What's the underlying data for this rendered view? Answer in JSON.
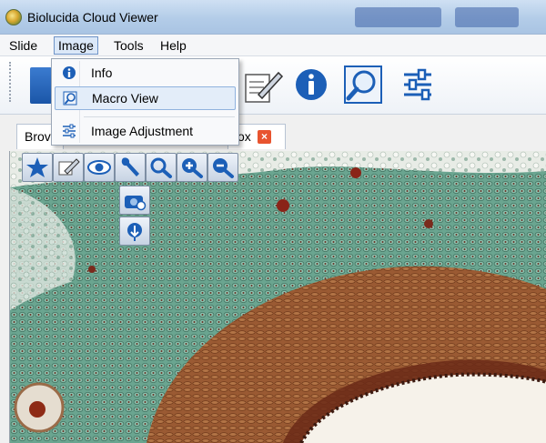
{
  "window": {
    "title": "Biolucida Cloud Viewer"
  },
  "menubar": {
    "items": [
      {
        "label": "Slide"
      },
      {
        "label": "Image"
      },
      {
        "label": "Tools"
      },
      {
        "label": "Help"
      }
    ]
  },
  "image_menu": {
    "items": [
      {
        "label": "Info",
        "icon": "info-icon"
      },
      {
        "label": "Macro View",
        "icon": "magnifier-icon"
      },
      {
        "label": "Image Adjustment",
        "icon": "sliders-icon"
      }
    ]
  },
  "tabs": [
    {
      "label": "Brov"
    },
    {
      "label": "ox"
    }
  ],
  "colors": {
    "accent": "#1b5fb8",
    "close": "#e8542f",
    "stain_green": "#5f9a86",
    "stain_brown": "#8c4a27"
  }
}
